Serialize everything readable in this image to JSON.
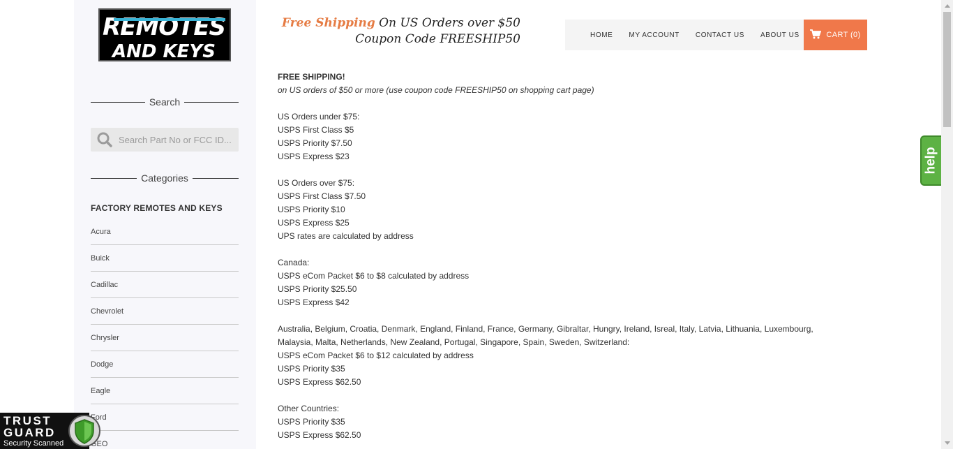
{
  "brand": {
    "logo_text_line1": "REMOTES",
    "logo_text_line2": "AND KEYS"
  },
  "promo": {
    "highlight": "Free Shipping",
    "line1_rest": " On US Orders over $50",
    "line2": "Coupon Code FREESHIP50"
  },
  "nav": {
    "items": [
      "HOME",
      "MY ACCOUNT",
      "CONTACT US",
      "ABOUT US"
    ],
    "cart_label": "CART (0)"
  },
  "sidebar": {
    "search_heading": "Search",
    "search_placeholder": "Search Part No or FCC ID...",
    "categories_heading": "Categories",
    "category_group": "FACTORY REMOTES AND KEYS",
    "categories": [
      "Acura",
      "Buick",
      "Cadillac",
      "Chevrolet",
      "Chrysler",
      "Dodge",
      "Eagle",
      "Ford",
      "GEO"
    ]
  },
  "content": {
    "title": "FREE SHIPPING!",
    "subtitle": "on US orders of $50 or more (use coupon code FREESHIP50 on shopping cart page)",
    "blocks": [
      [
        "US Orders under $75:",
        "USPS First Class $5",
        "USPS Priority $7.50",
        "USPS Express $23"
      ],
      [
        "US Orders over $75:",
        "USPS First Class $7.50",
        "USPS Priority $10",
        "USPS Express $25",
        "UPS rates are calculated by address"
      ],
      [
        "Canada:",
        "USPS eCom Packet $6 to $8 calculated by address",
        "USPS Priority $25.50",
        "USPS Express $42"
      ],
      [
        "Australia, Belgium, Croatia, Denmark, England, Finland, France, Germany, Gibraltar, Hungry, Ireland, Isreal, Italy, Latvia, Lithuania, Luxembourg,",
        "Malaysia, Malta, Netherlands, New Zealand, Portugal, Singapore, Spain, Sweden, Switzerland:",
        "USPS eCom Packet $6 to $12 calculated by address",
        "USPS Priority $35",
        "USPS Express $62.50"
      ],
      [
        "Other Countries:",
        "USPS Priority $35",
        "USPS Express $62.50"
      ]
    ]
  },
  "widgets": {
    "help_label": "help",
    "trust_line1": "TRUST",
    "trust_line2": "GUARD",
    "trust_line3": "Security Scanned"
  },
  "colors": {
    "accent": "#f0784a",
    "promo_highlight": "#e67c44",
    "help_green": "#5db244"
  }
}
